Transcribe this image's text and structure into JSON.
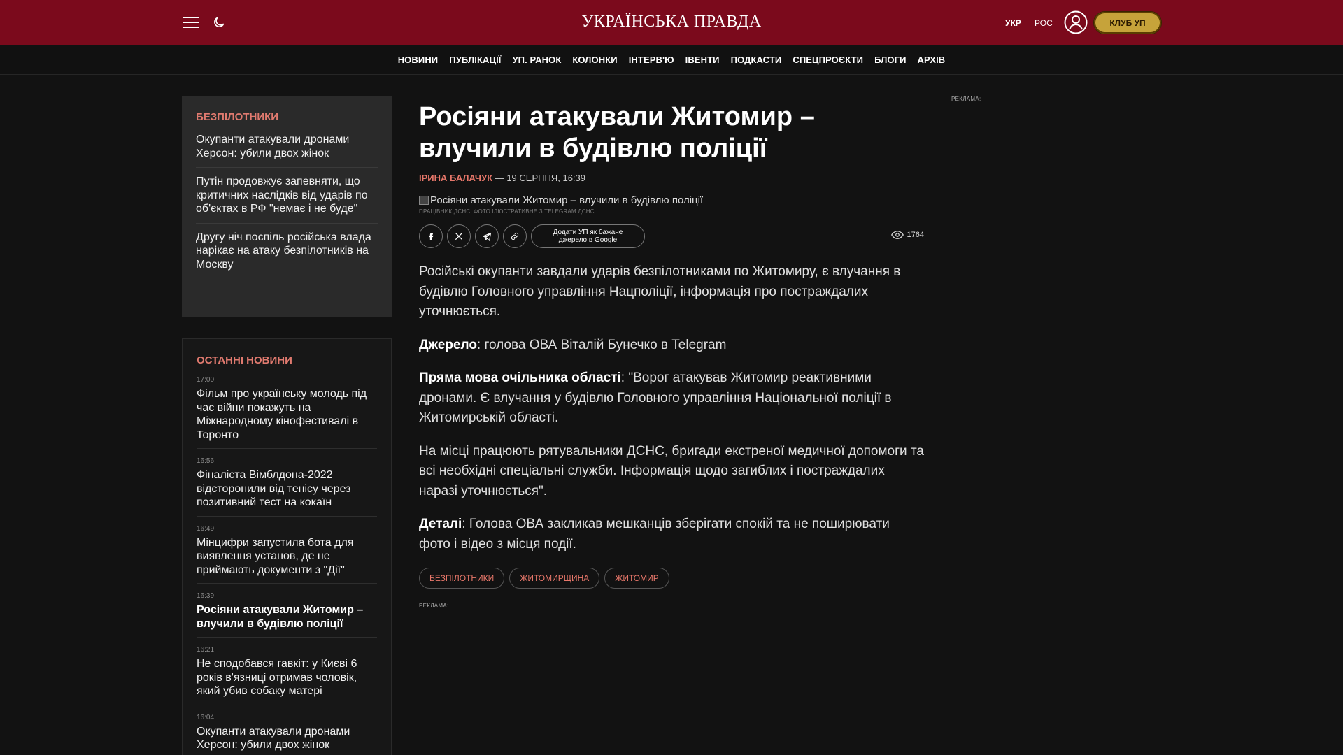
{
  "header": {
    "logo": "УКРАЇНСЬКА ПРАВДА",
    "lang_ukr": "УКР",
    "lang_ros": "РОС",
    "club_button": "КЛУБ УП",
    "colors": {
      "brand": "#7b0a1c",
      "accent": "#e8776a",
      "club": "#c6a33a"
    },
    "icons": [
      "menu-icon",
      "moon-icon",
      "user-icon"
    ]
  },
  "nav": [
    "НОВИНИ",
    "ПУБЛІКАЦІЇ",
    "УП. РАНОК",
    "КОЛОНКИ",
    "ІНТЕРВ'Ю",
    "ІВЕНТИ",
    "ПОДКАСТИ",
    "СПЕЦПРОЄКТИ",
    "БЛОГИ",
    "АРХІВ"
  ],
  "sidebar": {
    "topic_title": "БЕЗПІЛОТНИКИ",
    "topic_items": [
      "Окупанти атакували дронами Херсон: убили двох жінок",
      "Путін продовжує запевняти, що критичних наслідків від ударів по об'єктах в РФ \"немає і не буде\"",
      "Другу ніч поспіль російська влада нарікає на атаку безпілотників на Москву"
    ],
    "latest_title": "ОСТАННІ НОВИНИ",
    "latest": [
      {
        "time": "17:00",
        "text": "Фільм про українську молодь під час війни покажуть на Міжнародному кінофестивалі в Торонто"
      },
      {
        "time": "16:56",
        "text": "Фіналіста Вімблдона-2022 відсторонили від тенісу через позитивний тест на кокаїн"
      },
      {
        "time": "16:49",
        "text": "Мінцифри запустила бота для виявлення установ, де не приймають документи з \"Дії\""
      },
      {
        "time": "16:39",
        "text": "Росіяни атакували Житомир – влучили в будівлю поліції"
      },
      {
        "time": "16:21",
        "text": "Не сподобався гавкіт: у Києві 6 років в'язниці отримав чоловік, який убив собаку матері"
      },
      {
        "time": "16:04",
        "text": "Окупанти атакували дронами Херсон: убили двох жінок"
      }
    ]
  },
  "article": {
    "title": "Росіяни атакували Житомир – влучили в будівлю поліції",
    "author": "ІРИНА БАЛАЧУК",
    "date": "— 19 СЕРПНЯ, 16:39",
    "image_alt": "Росіяни атакували Житомир – влучили в будівлю поліції",
    "image_caption": "ПРАЦІВНИК ДСНС. ФОТО ІЛЮСТРАТИВНЕ З TELEGRAM ДСНС",
    "google_button": "Додати УП як бажане джерело в Google",
    "views": "1764",
    "share_icons": [
      "facebook-icon",
      "x-icon",
      "telegram-icon",
      "link-icon"
    ],
    "p1": "Російські окупанти завдали ударів безпілотниками по Житомиру, є влучання в будівлю Головного управління Нацполіції, інформація про постраждалих уточнюється.",
    "p2_label": "Джерело",
    "p2_pre": ": голова ОВА ",
    "p2_link": "Віталій Бунечко",
    "p2_post": " в Telegram",
    "p3_label": "Пряма мова очільника області",
    "p3_text": ": \"Ворог атакував Житомир реактивними дронами. Є влучання у будівлю Головного управління Національної поліції в Житомирській області.",
    "p4": "На місці працюють рятувальники ДСНС, бригади екстреної медичної допомоги та всі необхідні спеціальні служби. Інформація щодо загиблих і постраждалих наразі уточнюється\".",
    "p5_label": "Деталі",
    "p5_text": ": Голова ОВА закликав мешканців зберігати спокій та не поширювати фото і відео з місця події.",
    "tags": [
      "БЕЗПІЛОТНИКИ",
      "ЖИТОМИРЩИНА",
      "ЖИТОМИР"
    ],
    "ad_label": "РЕКЛАМА:"
  },
  "right_ad_label": "РЕКЛАМА:"
}
